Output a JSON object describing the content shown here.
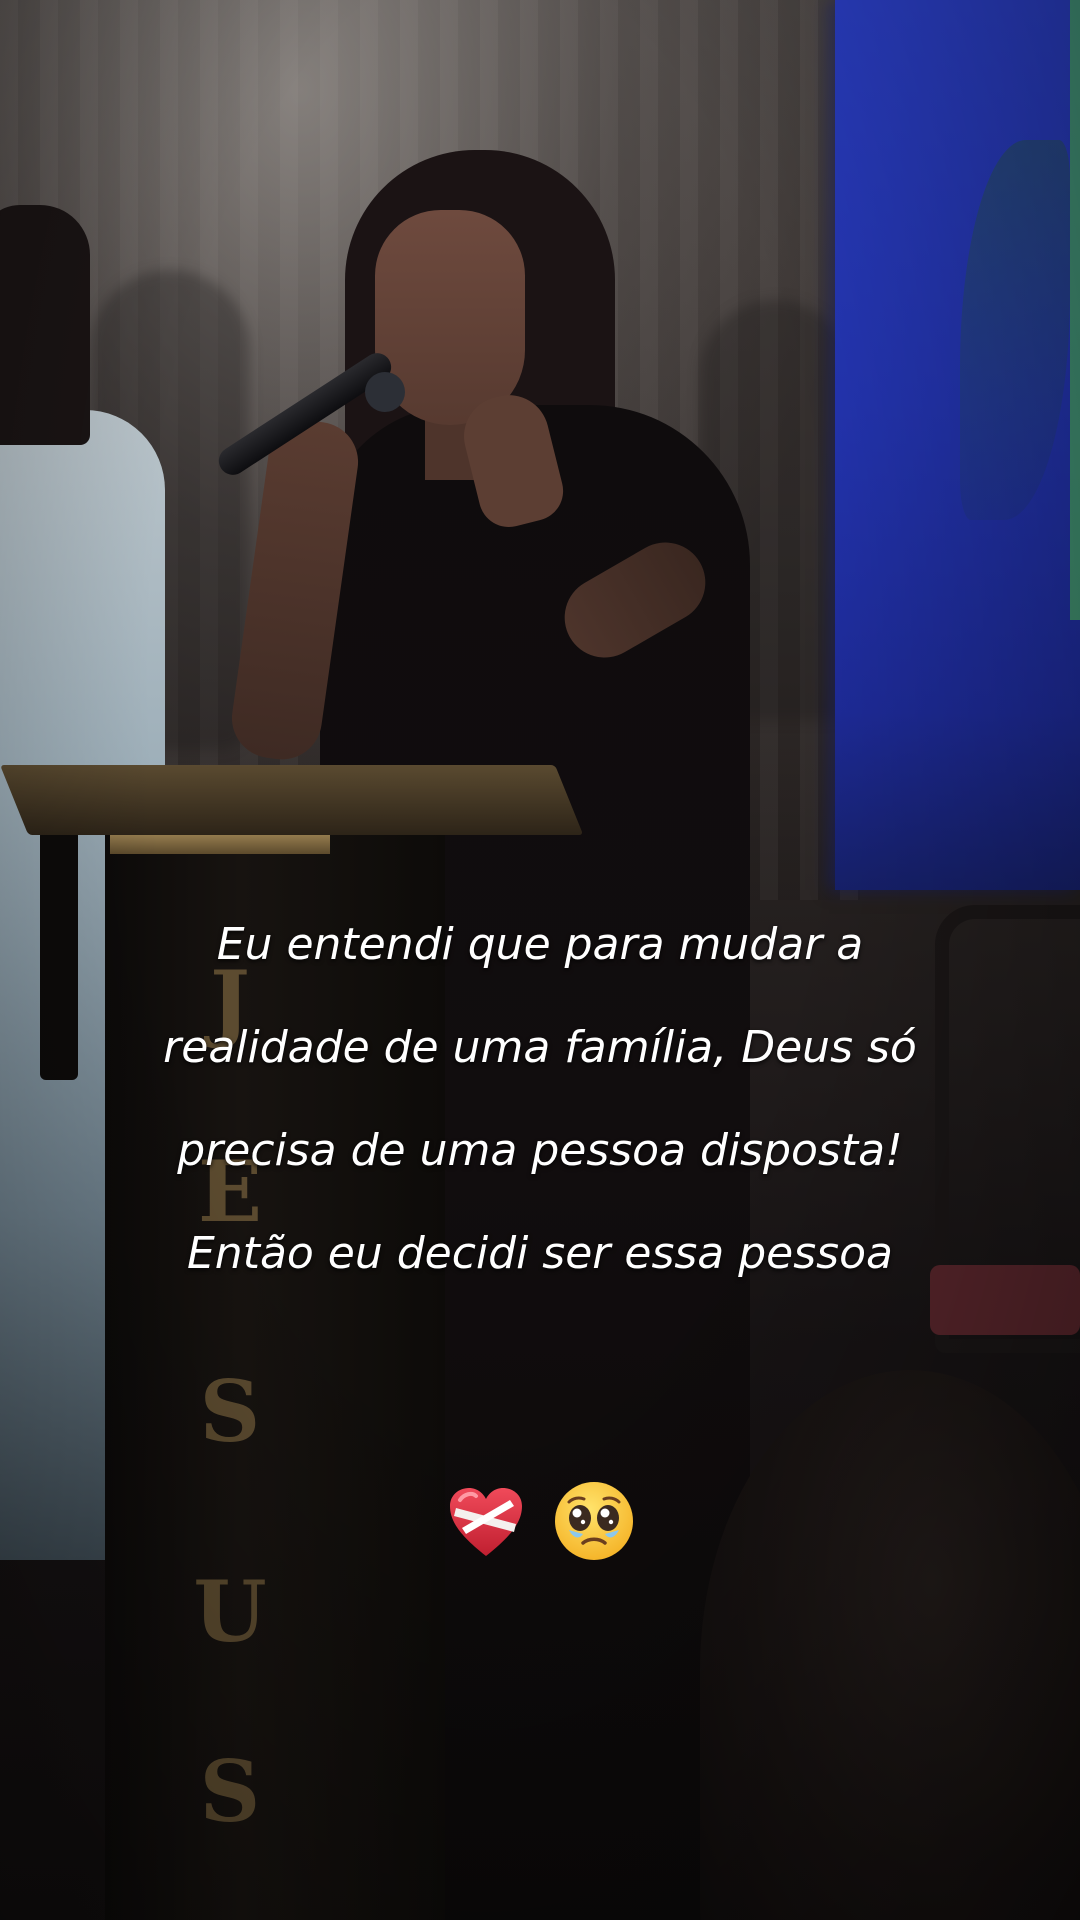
{
  "caption": {
    "lines": [
      "Eu entendi que para mudar a",
      "realidade de uma família, Deus só",
      "precisa de uma pessoa disposta!",
      "Então eu decidi ser essa pessoa"
    ]
  },
  "emojis": [
    {
      "name": "mending-heart-icon"
    },
    {
      "name": "pleading-face-icon"
    }
  ],
  "podium": {
    "letters": [
      "J",
      "E",
      "S",
      "U",
      "S"
    ]
  },
  "colors": {
    "screen_blue": "#2334b0",
    "caption_text": "#ffffff",
    "podium_gold": "#a88d5a"
  }
}
